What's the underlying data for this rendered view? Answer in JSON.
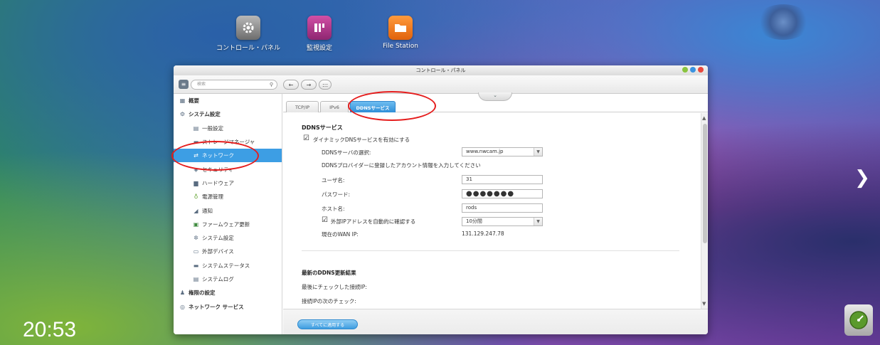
{
  "desktop": {
    "icons": [
      {
        "label": "コントロール・パネル",
        "icon": "gear-icon"
      },
      {
        "label": "監視設定",
        "icon": "surveillance-icon"
      },
      {
        "label": "File Station",
        "icon": "folder-icon"
      }
    ],
    "clock": "20:53",
    "colors": {
      "control_panel": "#8a8a8a",
      "surveillance": "#b0368c",
      "file_station": "#f07a1e"
    }
  },
  "window": {
    "title": "コントロール・パネル",
    "controls": [
      "minimize-icon",
      "maximize-icon",
      "close-icon"
    ],
    "toolbar": {
      "search_placeholder": "検索",
      "back": "←",
      "forward": "→",
      "apps": ":::"
    }
  },
  "sidebar": {
    "items": [
      {
        "label": "概要",
        "level": "top",
        "icon": "overview-icon"
      },
      {
        "label": "システム設定",
        "level": "top",
        "icon": "system-settings-icon"
      },
      {
        "label": "一般設定",
        "level": "sub",
        "icon": "general-icon"
      },
      {
        "label": "ストレージマネージャ",
        "level": "sub",
        "icon": "storage-icon"
      },
      {
        "label": "ネットワーク",
        "level": "sub",
        "icon": "network-icon",
        "active": true
      },
      {
        "label": "セキュリティ",
        "level": "sub",
        "icon": "security-icon"
      },
      {
        "label": "ハードウェア",
        "level": "sub",
        "icon": "hardware-icon"
      },
      {
        "label": "電源管理",
        "level": "sub",
        "icon": "power-icon"
      },
      {
        "label": "通知",
        "level": "sub",
        "icon": "notification-icon"
      },
      {
        "label": "ファームウェア更新",
        "level": "sub",
        "icon": "firmware-icon"
      },
      {
        "label": "システム設定",
        "level": "sub",
        "icon": "backup-icon"
      },
      {
        "label": "外部デバイス",
        "level": "sub",
        "icon": "external-device-icon"
      },
      {
        "label": "システムステータス",
        "level": "sub",
        "icon": "status-icon"
      },
      {
        "label": "システムログ",
        "level": "sub",
        "icon": "log-icon"
      },
      {
        "label": "権限の設定",
        "level": "top",
        "icon": "privilege-icon"
      },
      {
        "label": "ネットワーク サービス",
        "level": "top",
        "icon": "network-service-icon"
      }
    ]
  },
  "tabs": [
    {
      "label": "TCP/IP"
    },
    {
      "label": "IPv6"
    },
    {
      "label": "DDNSサービス",
      "active": true
    }
  ],
  "ddns": {
    "section_title": "DDNSサービス",
    "enable_label": "ダイナミックDNSサービスを有効にする",
    "enable_checked": true,
    "server_label": "DDNSサーバの選択:",
    "server_value": "www.nwcam.jp",
    "hint": "DDNSプロバイダーに登録したアカウント情報を入力してください",
    "username_label": "ユーザ名:",
    "username_value": "31",
    "password_label": "パスワード:",
    "password_value": "●●●●●●●",
    "hostname_label": "ホスト名:",
    "hostname_value": "rods",
    "auto_check_label": "外部IPアドレスを自動的に確認する",
    "auto_check_checked": true,
    "interval_value": "10分間",
    "wan_ip_label": "現在のWAN IP:",
    "wan_ip_value": "131.129.247.78"
  },
  "results": {
    "section_title": "最新のDDNS更新結果",
    "last_check_label": "最後にチェックした接続IP:",
    "next_check_label": "接続IPの次のチェック:"
  },
  "footer": {
    "apply_label": "すべてに適用する"
  },
  "annotation_color": "#e51d1d"
}
